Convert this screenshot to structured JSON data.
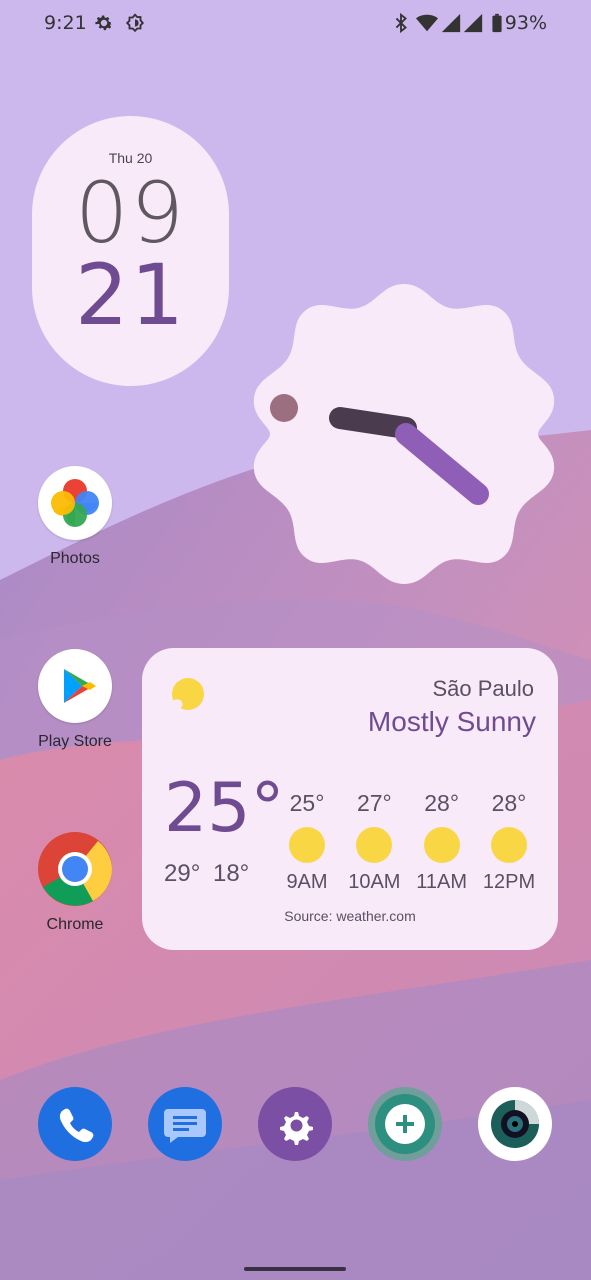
{
  "status_bar": {
    "time": "9:21",
    "left_icons": [
      "gear-icon",
      "brightness-icon"
    ],
    "right_icons": [
      "bluetooth-icon",
      "wifi-icon",
      "signal-icon",
      "signal-icon",
      "battery-icon"
    ],
    "battery_percent": "93%"
  },
  "clock_widget": {
    "date": "Thu 20",
    "hour": "09",
    "minute": "21"
  },
  "analog_clock": {
    "hour_hand_color": "#4a3b4e",
    "minute_hand_color": "#8f5fb7",
    "second_dot_color": "#9b6e80"
  },
  "apps": [
    {
      "label": "Photos",
      "icon": "photos-icon"
    },
    {
      "label": "Play Store",
      "icon": "play-store-icon"
    },
    {
      "label": "Chrome",
      "icon": "chrome-icon"
    }
  ],
  "weather": {
    "city": "São Paulo",
    "condition": "Mostly Sunny",
    "current_temp": "25°",
    "high": "29°",
    "low": "18°",
    "hourly": [
      {
        "temp": "25°",
        "hour": "9AM"
      },
      {
        "temp": "27°",
        "hour": "10AM"
      },
      {
        "temp": "28°",
        "hour": "11AM"
      },
      {
        "temp": "28°",
        "hour": "12PM"
      }
    ],
    "source": "Source: weather.com"
  },
  "dock": [
    "phone-icon",
    "messages-icon",
    "settings-icon",
    "add-chat-icon",
    "camera-icon"
  ],
  "colors": {
    "widget_bg": "#f8eaf9",
    "accent_purple": "#6f4c91",
    "sun_yellow": "#f9d644"
  }
}
